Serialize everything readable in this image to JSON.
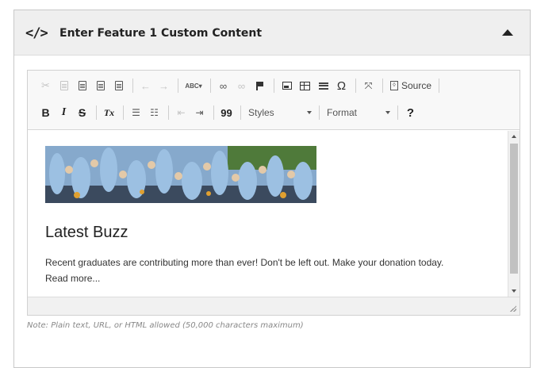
{
  "panel": {
    "title": "Enter Feature 1 Custom Content",
    "code_icon": "</>"
  },
  "toolbar": {
    "row1_icons": [
      "cut-icon",
      "copy-icon",
      "paste-icon",
      "paste-text-icon",
      "paste-word-icon",
      "undo-icon",
      "redo-icon",
      "spellcheck-icon",
      "link-icon",
      "unlink-icon",
      "anchor-icon",
      "image-icon",
      "table-icon",
      "horizontal-line-icon",
      "special-char-icon",
      "maximize-icon",
      "source-icon"
    ],
    "source_label": "Source",
    "bold_label": "B",
    "italic_label": "I",
    "strike_label": "S",
    "clear_format_label": "Tx",
    "blockquote_label": "99",
    "styles_label": "Styles",
    "format_label": "Format",
    "help_label": "?",
    "spellcheck_label": "ABC"
  },
  "content": {
    "heading": "Latest Buzz",
    "body": "Recent graduates are contributing more than ever! Don't be left out. Make your donation today.",
    "read_more": "Read more..."
  },
  "note": "Note: Plain text, URL, or HTML allowed (50,000 characters maximum)"
}
